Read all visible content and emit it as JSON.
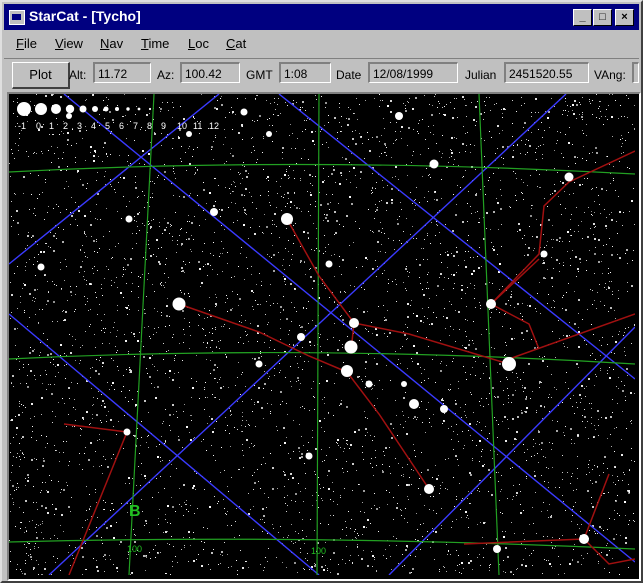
{
  "window": {
    "title": "StarCat - [Tycho]"
  },
  "title_buttons": {
    "minimize": "_",
    "maximize": "□",
    "close": "×"
  },
  "menu": [
    {
      "underline": "F",
      "rest": "ile"
    },
    {
      "underline": "V",
      "rest": "iew"
    },
    {
      "underline": "N",
      "rest": "av"
    },
    {
      "underline": "T",
      "rest": "ime"
    },
    {
      "underline": "L",
      "rest": "oc"
    },
    {
      "underline": "C",
      "rest": "at"
    }
  ],
  "toolbar": {
    "plot_label": "Plot",
    "alt_label": "Alt:",
    "alt_value": "11.72",
    "az_label": "Az:",
    "az_value": "100.42",
    "gmt_label": "GMT",
    "gmt_value": "1:08",
    "date_label": "Date",
    "date_value": "12/08/1999",
    "julian_label": "Julian",
    "julian_value": "2451520.55",
    "vang_label": "VAng:"
  },
  "sky": {
    "magnitude_legend": [
      "-1",
      "0",
      "1",
      "2",
      "3",
      "4",
      "5",
      "6",
      "7",
      "8",
      "9",
      "10",
      "11",
      "12"
    ],
    "grid_labels": [
      "100",
      "100"
    ],
    "marker_label": "B",
    "colors": {
      "background": "#000000",
      "stars": "#ffffff",
      "grid_green": "#22a022",
      "grid_blue": "#3a3aff",
      "constellation": "#a01010"
    }
  }
}
